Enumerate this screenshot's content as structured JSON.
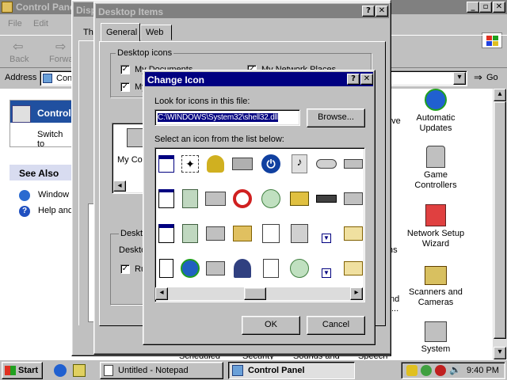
{
  "control_panel": {
    "title": "Control Panel",
    "menu": [
      "File",
      "Edit"
    ],
    "toolbar": {
      "back": "Back",
      "forward": "Forwa",
      "go": "Go"
    },
    "address_label": "Address",
    "address_value": "Cont",
    "left_pane": {
      "heading": "Control",
      "switch_link": "Switch to",
      "see_also": "See Also",
      "links": [
        "Window",
        "Help and"
      ]
    },
    "right_items": [
      "Automatic Updates",
      "Game Controllers",
      "Network Setup Wizard",
      "Scanners and Cameras",
      "System"
    ],
    "partial_labels": [
      "rive",
      "ns",
      "nd",
      "...",
      "Scheduled",
      "Security",
      "Sounds and",
      "Speech"
    ]
  },
  "display_window": {
    "title": "Disp",
    "tab_partial": "Th"
  },
  "desktop_items": {
    "title": "Desktop Items",
    "tabs": [
      "General",
      "Web"
    ],
    "group_title": "Desktop icons",
    "checkboxes": [
      "My Documents",
      "My Network Places",
      "My"
    ],
    "list_label": "My Co",
    "group2_title": "Deskto",
    "group2_text": "Deskto",
    "group2_cb": "Ru"
  },
  "change_icon": {
    "title": "Change Icon",
    "look_label": "Look for icons in this file:",
    "file_value": "C:\\WINDOWS\\System32\\shell32.dll",
    "browse_label": "Browse...",
    "select_label": "Select an icon from the list below:",
    "ok_label": "OK",
    "cancel_label": "Cancel"
  },
  "taskbar": {
    "start": "Start",
    "tasks": [
      "Untitled - Notepad",
      "Control Panel"
    ],
    "clock": "9:40 PM"
  },
  "colors": {
    "title_active": "#000080",
    "title_inactive": "#808080",
    "face": "#c0c0c0",
    "selection": "#000080"
  }
}
